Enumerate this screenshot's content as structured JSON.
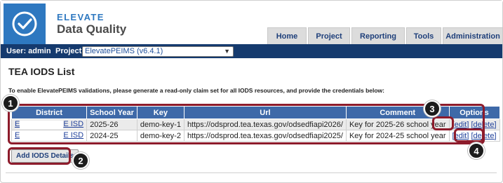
{
  "brand": {
    "top": "ELEVATE",
    "main": "Data Quality",
    "logo_icon": "checkmark-circle-icon"
  },
  "nav": {
    "tabs": [
      "Home",
      "Project",
      "Reporting",
      "Tools",
      "Administration"
    ]
  },
  "userbar": {
    "user_text": "User: admin",
    "project_label": "Project:",
    "project_value": "ElevatePEIMS (v6.4.1)"
  },
  "page": {
    "title": "TEA IODS List",
    "instruction": "To enable ElevatePEIMS validations, please generate a read-only claim set for all IODS resources, and provide the credentials below:"
  },
  "table": {
    "headers": [
      "District",
      "School Year",
      "Key",
      "Url",
      "Comment",
      "Options"
    ],
    "rows": [
      {
        "district_prefix": "E",
        "district_suffix": "E ISD",
        "school_year": "2025-26",
        "key": "demo-key-1",
        "url": "https://odsprod.tea.texas.gov/odsedfiapi2026/",
        "comment": "Key for 2025-26 school year",
        "edit": "[edit]",
        "delete": "[delete]"
      },
      {
        "district_prefix": "E",
        "district_suffix": "E ISD",
        "school_year": "2024-25",
        "key": "demo-key-2",
        "url": "https://odsprod.tea.texas.gov/odsedfiapi2025/",
        "comment": "Key for 2024-25 school year",
        "edit": "[edit]",
        "delete": "[delete]"
      }
    ]
  },
  "add_button": "Add IODS Details",
  "callouts": [
    "1",
    "2",
    "3",
    "4"
  ],
  "colors": {
    "brand_blue": "#2e78c0",
    "nav_bar": "#153a6e",
    "table_header": "#3e69a8",
    "highlight": "#8d1b2b"
  }
}
